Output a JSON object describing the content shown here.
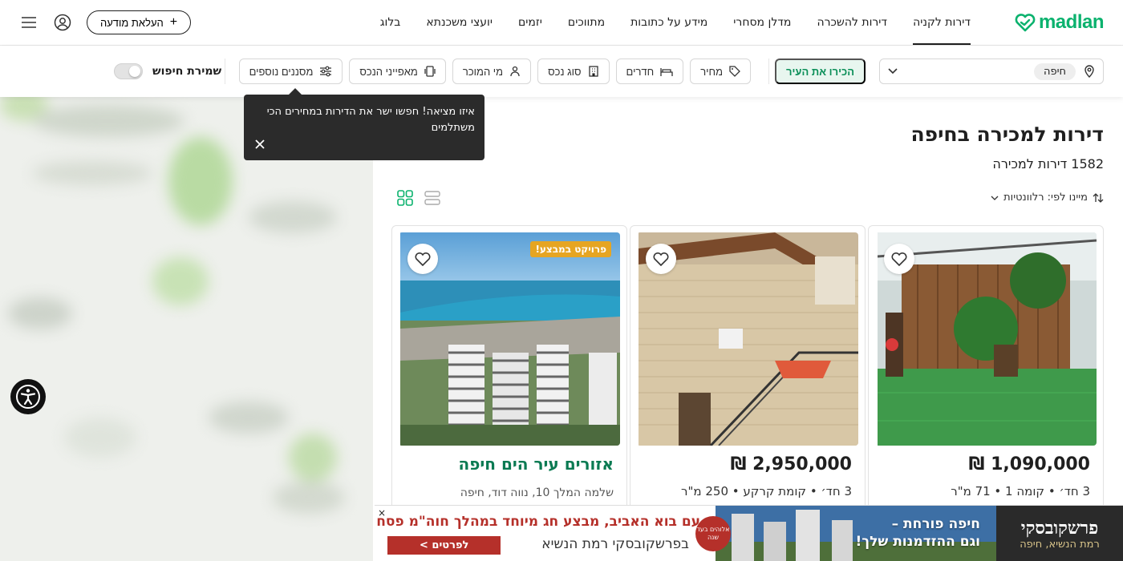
{
  "nav": {
    "logo": "madlan",
    "links": [
      {
        "label": "דירות לקניה",
        "active": true
      },
      {
        "label": "דירות להשכרה",
        "active": false
      },
      {
        "label": "מדלן מסחרי",
        "active": false
      },
      {
        "label": "מידע על כתובות",
        "active": false
      },
      {
        "label": "מתווכים",
        "active": false
      },
      {
        "label": "יזמים",
        "active": false
      },
      {
        "label": "יועצי משכנתא",
        "active": false
      },
      {
        "label": "בלוג",
        "active": false
      }
    ],
    "upload_label": "העלאת מודעה",
    "menu_icon": "hamburger-icon",
    "user_icon": "user-icon"
  },
  "filters": {
    "search_value": "חיפה",
    "know_city": "הכירו את העיר",
    "buttons": [
      {
        "label": "מחיר",
        "icon": "tag-icon"
      },
      {
        "label": "חדרים",
        "icon": "bed-icon"
      },
      {
        "label": "סוג נכס",
        "icon": "building-icon"
      },
      {
        "label": "מי המוכר",
        "icon": "seller-icon"
      },
      {
        "label": "מאפייני הנכס",
        "icon": "features-icon"
      },
      {
        "label": "מסננים נוספים",
        "icon": "sliders-icon"
      }
    ],
    "save_search": "שמירת חיפוש"
  },
  "tooltip": {
    "text": "איזו מציאה! חפשו ישר את הדירות במחירים הכי משתלמים"
  },
  "listing": {
    "title": "דירות למכירה בחיפה",
    "count": "1582 דירות למכירה",
    "sort_label": "מיינו לפי: רלוונטיות",
    "cards": [
      {
        "price": "1,090,000 ₪",
        "details": "3 חד׳ • קומה 1 • 71 מ\"ר"
      },
      {
        "price": "2,950,000 ₪",
        "details": "3 חד׳ • קומת קרקע • 250 מ\"ר"
      },
      {
        "badge": "פרויקט במבצע!",
        "project": "אזורים עיר הים חיפה",
        "address": "שלמה המלך 10, נווה דוד, חיפה"
      }
    ]
  },
  "ad": {
    "brand": "פרשקובסקי",
    "brand_sub": "רמת הנשיא, חיפה",
    "headline_1": "חיפה פורחת –",
    "headline_2": "וגם ההזדמנות שלך!",
    "line1": "עם בוא האביב, מבצע חג מיוחד במהלך חוה\"מ פסח",
    "line2": "בפרשקובסקי רמת הנשיא",
    "cta": "לפרטים >",
    "seal": "אלוהים בעד שנה",
    "close": "×"
  },
  "colors": {
    "brand_green": "#0bb26e",
    "project_green": "#0a7a52",
    "badge_orange": "#e6a522",
    "ad_red": "#b5302a"
  }
}
